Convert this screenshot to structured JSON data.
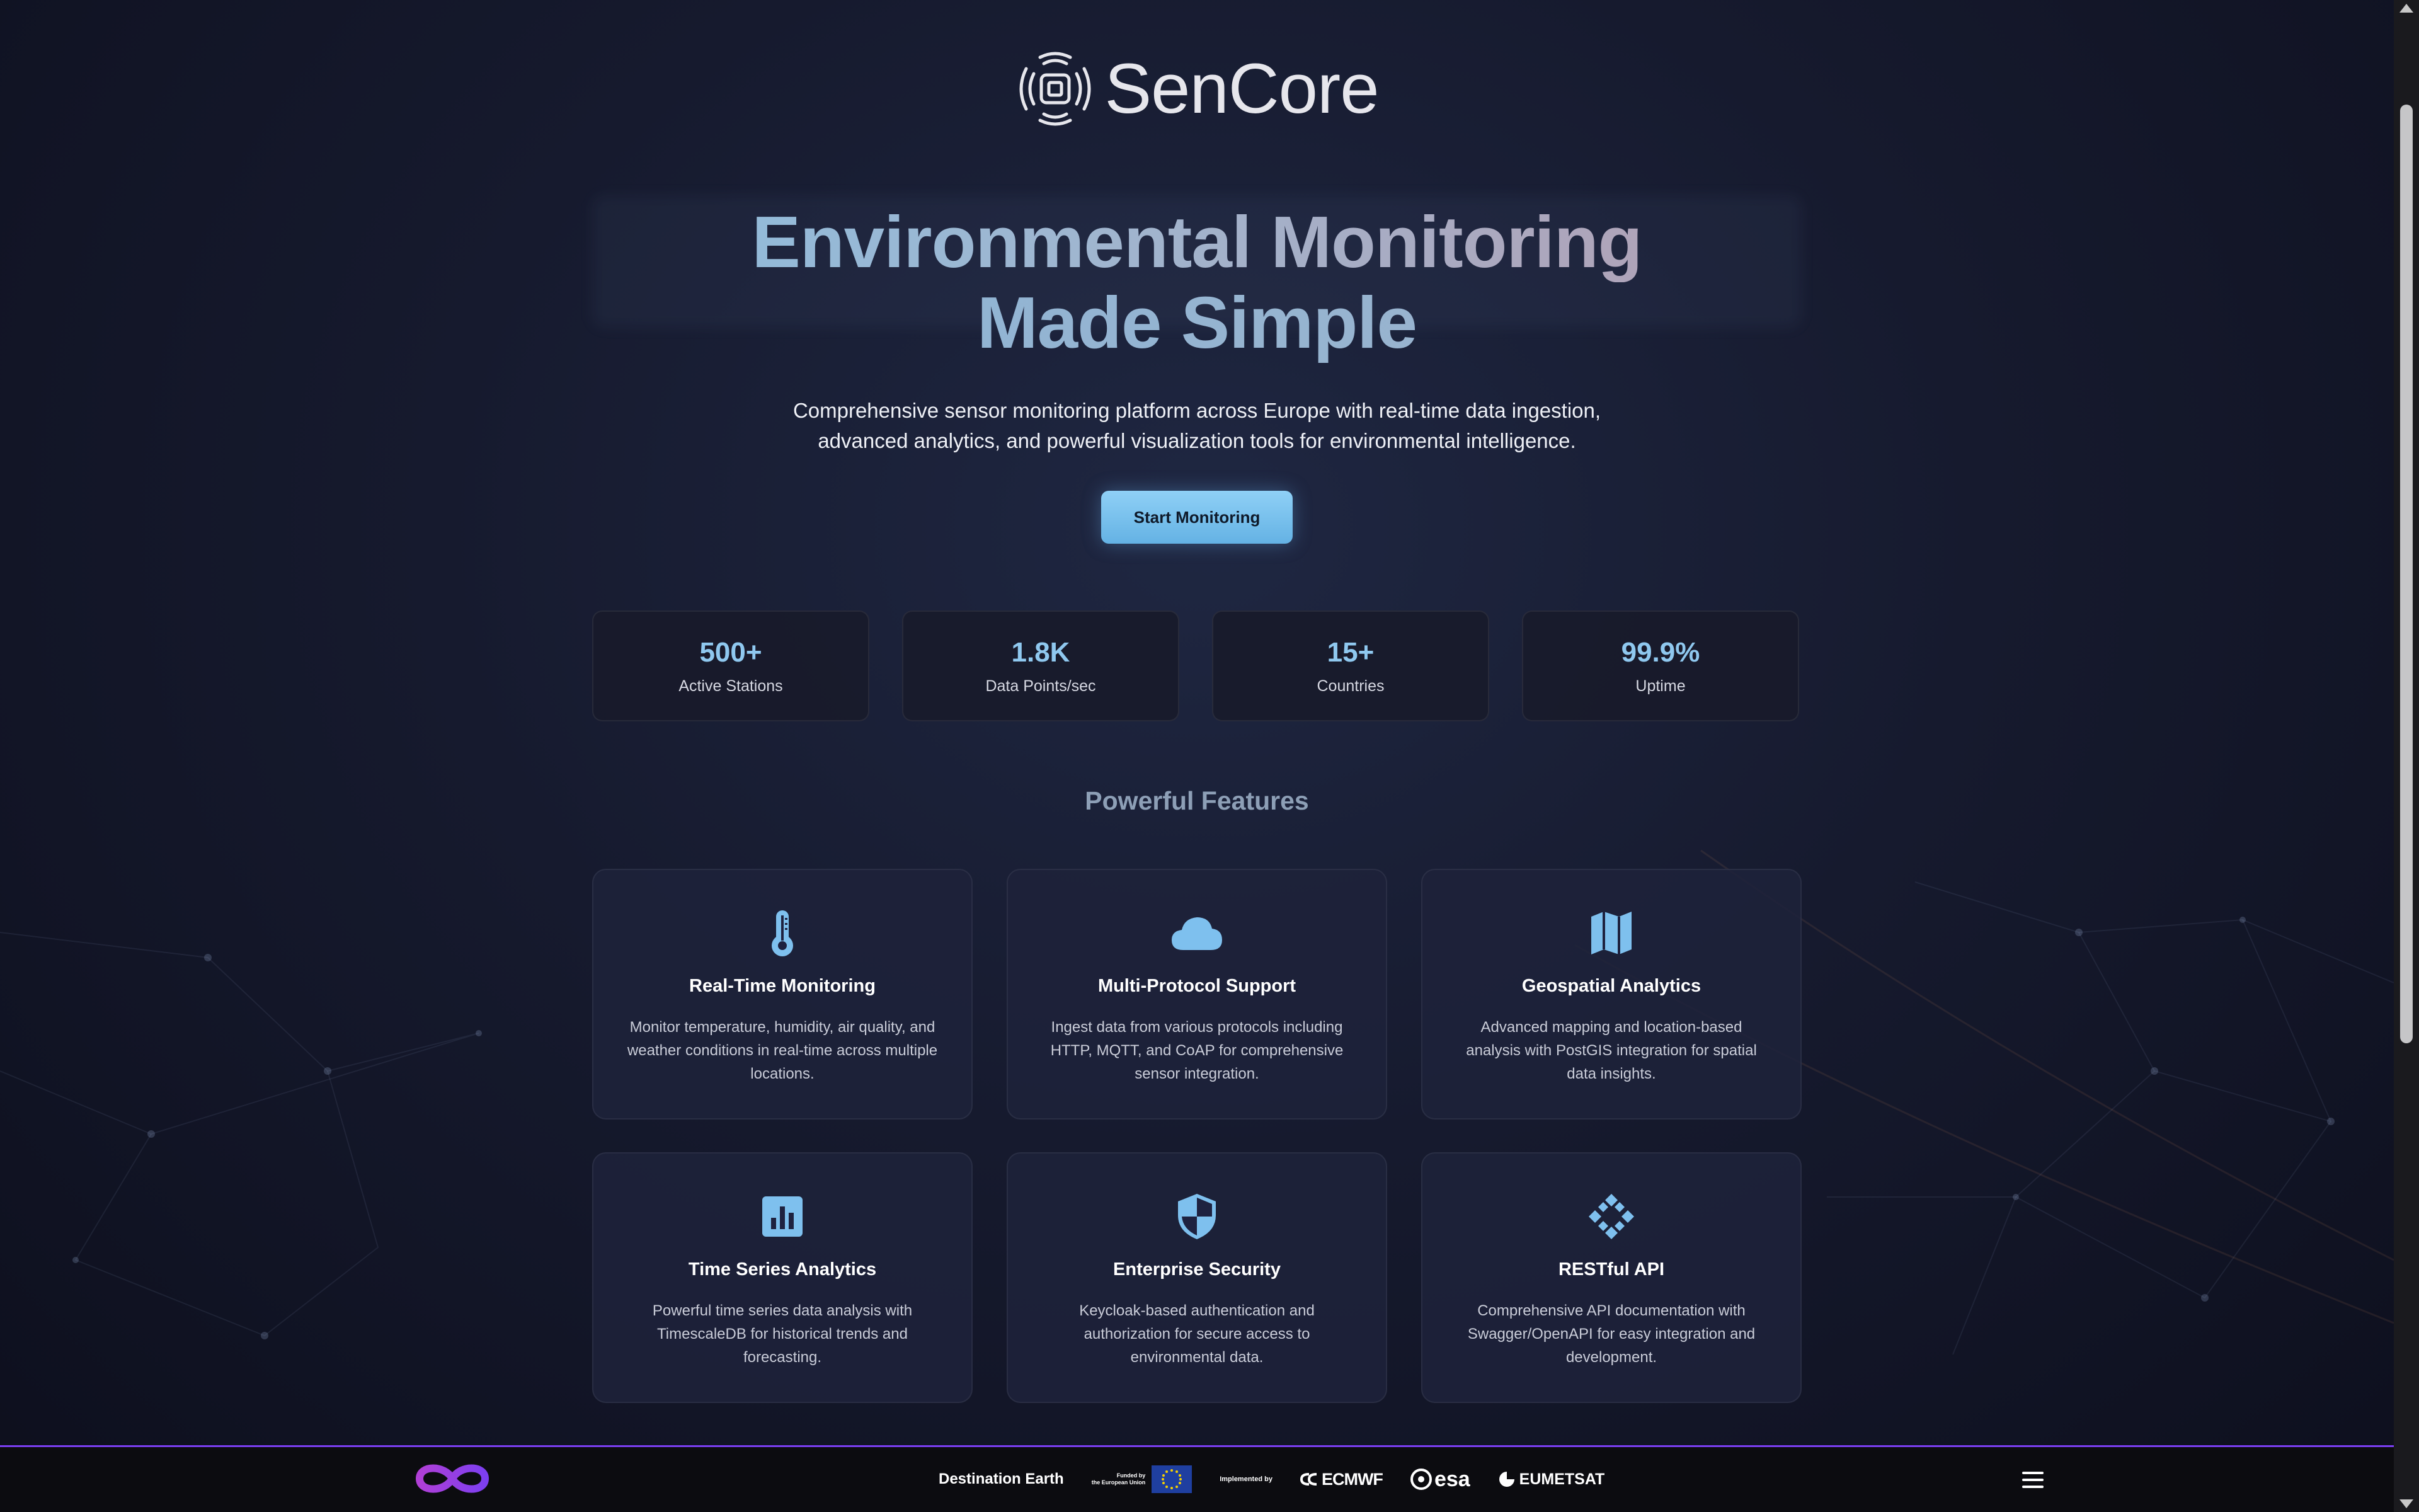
{
  "brand": {
    "name": "SenCore",
    "logo_icon": "sensor-chip-icon"
  },
  "hero": {
    "title_line1": "Environmental Monitoring",
    "title_line2": "Made Simple",
    "subtitle_line1": "Comprehensive sensor monitoring platform across Europe with real-time data ingestion,",
    "subtitle_line2": "advanced analytics, and powerful visualization tools for environmental intelligence.",
    "cta_label": "Start Monitoring"
  },
  "stats": [
    {
      "value": "500+",
      "label": "Active Stations"
    },
    {
      "value": "1.8K",
      "label": "Data Points/sec"
    },
    {
      "value": "15+",
      "label": "Countries"
    },
    {
      "value": "99.9%",
      "label": "Uptime"
    }
  ],
  "features": {
    "title": "Powerful Features",
    "items": [
      {
        "icon": "thermometer-icon",
        "title": "Real-Time Monitoring",
        "desc": "Monitor temperature, humidity, air quality, and weather conditions in real-time across multiple locations."
      },
      {
        "icon": "cloud-icon",
        "title": "Multi-Protocol Support",
        "desc": "Ingest data from various protocols including HTTP, MQTT, and CoAP for comprehensive sensor integration."
      },
      {
        "icon": "map-icon",
        "title": "Geospatial Analytics",
        "desc": "Advanced mapping and location-based analysis with PostGIS integration for spatial data insights."
      },
      {
        "icon": "chart-icon",
        "title": "Time Series Analytics",
        "desc": "Powerful time series data analysis with TimescaleDB for historical trends and forecasting."
      },
      {
        "icon": "shield-icon",
        "title": "Enterprise Security",
        "desc": "Keycloak-based authentication and authorization for secure access to environmental data."
      },
      {
        "icon": "api-icon",
        "title": "RESTful API",
        "desc": "Comprehensive API documentation with Swagger/OpenAPI for easy integration and development."
      }
    ]
  },
  "footer": {
    "destination_earth": "Destination Earth",
    "funded_by_line1": "Funded by",
    "funded_by_line2": "the European Union",
    "implemented_by": "Implemented by",
    "ecmwf": "ECMWF",
    "esa": "esa",
    "eumetsat": "EUMETSAT",
    "menu_icon": "hamburger-menu-icon"
  },
  "colors": {
    "accent": "#8fc8ef",
    "cta": "#74bdea",
    "footer_border": "#7b3ff2",
    "background": "#161a2e"
  }
}
